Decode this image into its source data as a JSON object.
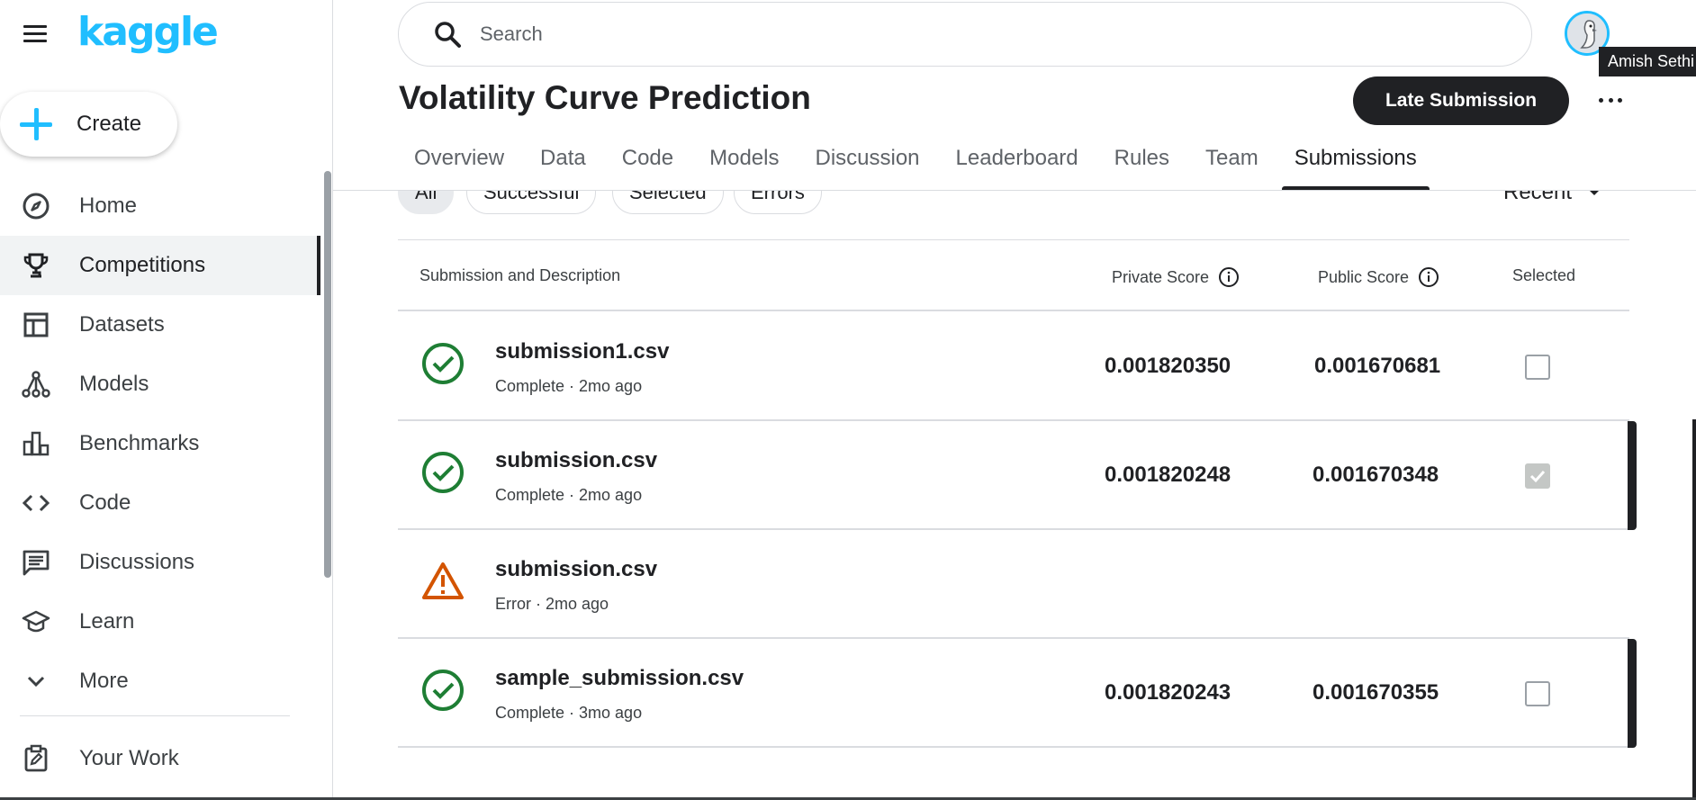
{
  "brand": {
    "logo_text": "kaggle",
    "accent_color": "#20beff"
  },
  "sidebar": {
    "menu_icon": "hamburger-menu-icon",
    "create_label": "Create",
    "items": [
      {
        "label": "Home",
        "icon": "compass-icon",
        "active": false
      },
      {
        "label": "Competitions",
        "icon": "trophy-icon",
        "active": true
      },
      {
        "label": "Datasets",
        "icon": "table-icon",
        "active": false
      },
      {
        "label": "Models",
        "icon": "models-icon",
        "active": false
      },
      {
        "label": "Benchmarks",
        "icon": "bar-chart-icon",
        "active": false
      },
      {
        "label": "Code",
        "icon": "code-icon",
        "active": false
      },
      {
        "label": "Discussions",
        "icon": "comment-icon",
        "active": false
      },
      {
        "label": "Learn",
        "icon": "graduation-cap-icon",
        "active": false
      },
      {
        "label": "More",
        "icon": "chevron-down-icon",
        "active": false
      }
    ],
    "your_work_label": "Your Work"
  },
  "search": {
    "placeholder": "Search"
  },
  "user": {
    "name": "Amish Sethi"
  },
  "header": {
    "title": "Volatility Curve Prediction",
    "late_submission_label": "Late Submission"
  },
  "tabs": [
    {
      "label": "Overview",
      "active": false
    },
    {
      "label": "Data",
      "active": false
    },
    {
      "label": "Code",
      "active": false
    },
    {
      "label": "Models",
      "active": false
    },
    {
      "label": "Discussion",
      "active": false
    },
    {
      "label": "Leaderboard",
      "active": false
    },
    {
      "label": "Rules",
      "active": false
    },
    {
      "label": "Team",
      "active": false
    },
    {
      "label": "Submissions",
      "active": true
    }
  ],
  "filters": {
    "chips": [
      "All",
      "Successful",
      "Selected",
      "Errors"
    ],
    "sort_label": "Recent"
  },
  "table": {
    "headers": {
      "submission": "Submission and Description",
      "private": "Private Score",
      "public": "Public Score",
      "selected": "Selected"
    },
    "rows": [
      {
        "file": "submission1.csv",
        "meta": "Complete · 2mo ago",
        "status": "complete",
        "private": "0.001820350",
        "public": "0.001670681",
        "selected": false
      },
      {
        "file": "submission.csv",
        "meta": "Complete · 2mo ago",
        "status": "complete",
        "private": "0.001820248",
        "public": "0.001670348",
        "selected": true
      },
      {
        "file": "submission.csv",
        "meta": "Error · 2mo ago",
        "status": "error",
        "private": "",
        "public": "",
        "selected": false
      },
      {
        "file": "sample_submission.csv",
        "meta": "Complete · 3mo ago",
        "status": "complete",
        "private": "0.001820243",
        "public": "0.001670355",
        "selected": false
      }
    ]
  },
  "colors": {
    "success": "#1e7e34",
    "error": "#d35400",
    "text_primary": "#202124"
  }
}
